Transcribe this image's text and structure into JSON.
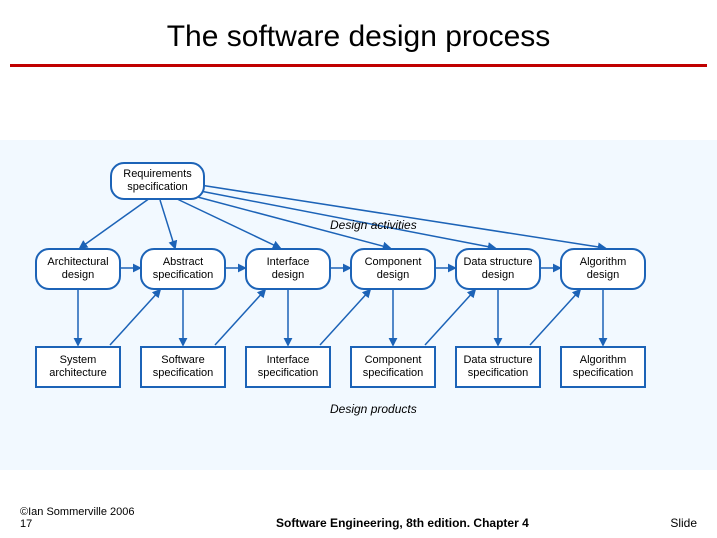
{
  "title": "The software design process",
  "section_labels": {
    "activities": "Design activities",
    "products": "Design products"
  },
  "top_node": "Requirements specification",
  "activity_nodes": [
    "Architectural design",
    "Abstract specification",
    "Interface design",
    "Component design",
    "Data structure design",
    "Algorithm design"
  ],
  "product_nodes": [
    "System architecture",
    "Software specification",
    "Interface specification",
    "Component specification",
    "Data structure specification",
    "Algorithm specification"
  ],
  "footer": {
    "left_top": "©Ian Sommerville 2006",
    "left_bottom": "17",
    "center": "Software Engineering, 8th edition. Chapter 4",
    "right": "Slide"
  }
}
